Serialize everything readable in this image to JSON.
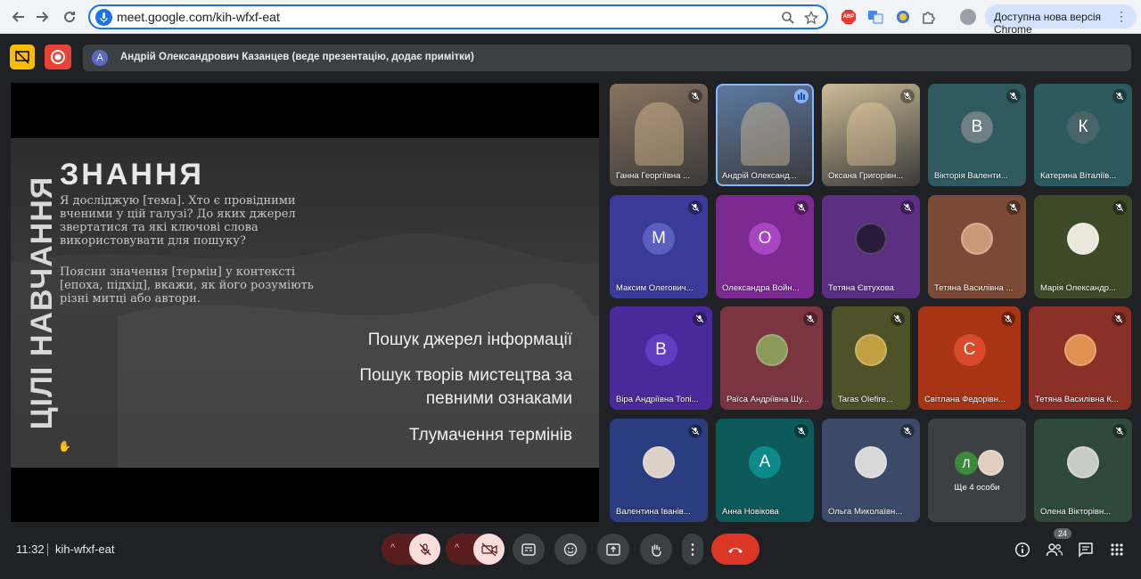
{
  "browser": {
    "url": "meet.google.com/kih-wfxf-eat",
    "update_label": "Доступна нова версія Chrome",
    "abp_label": "ABP"
  },
  "banner": {
    "avatar_letter": "A",
    "text": "Андрій Олександрович Казанцев (веде презентацію, додає примітки)"
  },
  "slide": {
    "vertical_title": "ЦІЛІ НАВЧАННЯ",
    "title": "ЗНАННЯ",
    "paragraph1": "Я досліджую [тема]. Хто є провідними вченими у цій галузі? До яких джерел звертатися та які ключові слова використовувати для пошуку?",
    "paragraph2": "Поясни значення [термін] у контексті [епоха, підхід], вкажи, як його розуміють різні митці або автори.",
    "bullet1": "Пошук джерел інформації",
    "bullet2a": "Пошук творів мистецтва за",
    "bullet2b": "певними ознаками",
    "bullet3": "Тлумачення термінів"
  },
  "participants": [
    {
      "name": "Ганна Георгіївна ...",
      "type": "video",
      "bg": "#8a7360"
    },
    {
      "name": "Андрій Олександ...",
      "type": "video",
      "bg": "#5d7aa3",
      "speaking": true
    },
    {
      "name": "Оксана Григорівн...",
      "type": "video",
      "bg": "#cdbb96"
    },
    {
      "name": "Вікторія Валенти...",
      "type": "letter",
      "letter": "В",
      "bg": "#2f5a60",
      "avatar_bg": "#6f7f86"
    },
    {
      "name": "Катерина Віталіїв...",
      "type": "letter",
      "letter": "К",
      "bg": "#2d5a5e",
      "avatar_bg": "#4a6468"
    },
    {
      "name": "Максим Олегович...",
      "type": "letter",
      "letter": "M",
      "bg": "#3b3a98",
      "avatar_bg": "#5b5fc0"
    },
    {
      "name": "Олександра Войн...",
      "type": "letter",
      "letter": "О",
      "bg": "#7a2a90",
      "avatar_bg": "#a845c0"
    },
    {
      "name": "Тетяна Євтухова",
      "type": "photo",
      "bg": "#5b2f82",
      "photo_bg": "#2a1a3a"
    },
    {
      "name": "Тетяна Василівна ...",
      "type": "photo",
      "bg": "#7a4a36",
      "photo_bg": "#c99a78"
    },
    {
      "name": "Марія Олександр...",
      "type": "photo",
      "bg": "#3d4a28",
      "photo_bg": "#ece6dc"
    },
    {
      "name": "Віра Андріївна Топі...",
      "type": "letter",
      "letter": "B",
      "bg": "#4a2a9a",
      "avatar_bg": "#5f3fc0"
    },
    {
      "name": "Раїса Андріївна Шу...",
      "type": "photo",
      "bg": "#7a3540",
      "photo_bg": "#8a9a58"
    },
    {
      "name": "Taras Olefire...",
      "type": "photo",
      "bg": "#4e5228",
      "photo_bg": "#c0a040"
    },
    {
      "name": "Світлана Федорівн...",
      "type": "letter",
      "letter": "C",
      "bg": "#a83416",
      "avatar_bg": "#d84a2a"
    },
    {
      "name": "Тетяна Василівна К...",
      "type": "photo",
      "bg": "#8a3026",
      "photo_bg": "#e09050"
    },
    {
      "name": "Валентина Іванів...",
      "type": "photo",
      "bg": "#2a3d80",
      "photo_bg": "#dcd0c8"
    },
    {
      "name": "Анна Новікова",
      "type": "letter",
      "letter": "A",
      "bg": "#0d5a5a",
      "avatar_bg": "#0f8a8a"
    },
    {
      "name": "Ольга Миколаївн...",
      "type": "photo",
      "bg": "#3a4a68",
      "photo_bg": "#d8d8d8"
    },
    {
      "name": "Олена Вікторівн...",
      "type": "photo",
      "bg": "#2f4a3a",
      "photo_bg": "#c8ccc8"
    }
  ],
  "others": {
    "letter": "Л",
    "label": "Ще 4 особи"
  },
  "bottom": {
    "time": "11:32",
    "meeting_code": "kih-wfxf-eat",
    "participant_count": "24"
  }
}
